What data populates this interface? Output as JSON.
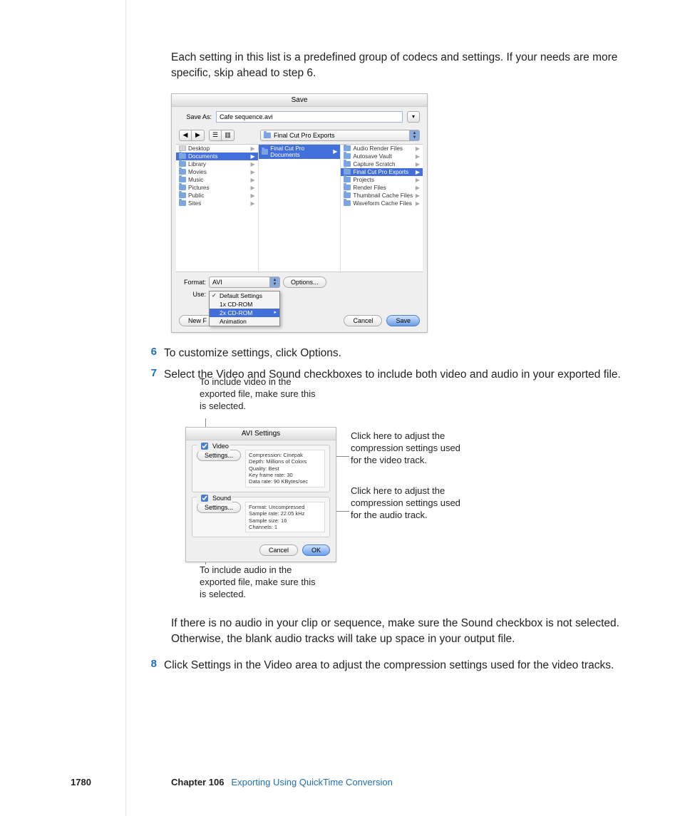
{
  "intro": "Each setting in this list is a predefined group of codecs and settings. If your needs are more specific, skip ahead to step 6.",
  "steps": {
    "6": "To customize settings, click Options.",
    "7": "Select the Video and Sound checkboxes to include both video and audio in your exported file.",
    "8": "Click Settings in the Video area to adjust the compression settings used for the video tracks."
  },
  "note": "If there is no audio in your clip or sequence, make sure the Sound checkbox is not selected. Otherwise, the blank audio tracks will take up space in your output file.",
  "footer": {
    "page": "1780",
    "chapter": "Chapter 106",
    "title": "Exporting Using QuickTime Conversion"
  },
  "save_dialog": {
    "title": "Save",
    "save_as_label": "Save As:",
    "save_as_value": "Cafe sequence.avi",
    "path_popup": "Final Cut Pro Exports",
    "columns": {
      "c1": [
        "Desktop",
        "Documents",
        "Library",
        "Movies",
        "Music",
        "Pictures",
        "Public",
        "Sites"
      ],
      "c1_selected": "Documents",
      "c2": [
        "Final Cut Pro Documents"
      ],
      "c2_selected": "Final Cut Pro Documents",
      "c3": [
        "Audio Render Files",
        "Autosave Vault",
        "Capture Scratch",
        "Final Cut Pro Exports",
        "Projects",
        "Render Files",
        "Thumbnail Cache Files",
        "Waveform Cache Files"
      ],
      "c3_selected": "Final Cut Pro Exports"
    },
    "format_label": "Format:",
    "format_value": "AVI",
    "options_button": "Options...",
    "use_label": "Use:",
    "use_menu": [
      "Default Settings",
      "1x CD-ROM",
      "2x CD-ROM",
      "Animation"
    ],
    "use_checked": "Default Settings",
    "use_highlighted": "2x CD-ROM",
    "newfolder_button": "New F",
    "cancel_button": "Cancel",
    "save_button": "Save"
  },
  "callouts": {
    "video_include": "To include video in the exported file, make sure this is selected.",
    "video_settings": "Click here to adjust the compression settings used for the video track.",
    "sound_include": "To include audio in the exported file, make sure this is selected.",
    "sound_settings": "Click here to adjust the compression settings used for the audio track."
  },
  "avi_dialog": {
    "title": "AVI Settings",
    "video_legend": "Video",
    "sound_legend": "Sound",
    "settings_button": "Settings...",
    "video_details": [
      "Compression: Cinepak",
      "Depth: Millions of Colors",
      "Quality: Best",
      "Key frame rate: 30",
      "Data rate: 90 KBytes/sec"
    ],
    "sound_details": [
      "Format: Uncompressed",
      "Sample rate: 22.05 kHz",
      "Sample size: 16",
      "Channels: 1"
    ],
    "cancel_button": "Cancel",
    "ok_button": "OK"
  }
}
